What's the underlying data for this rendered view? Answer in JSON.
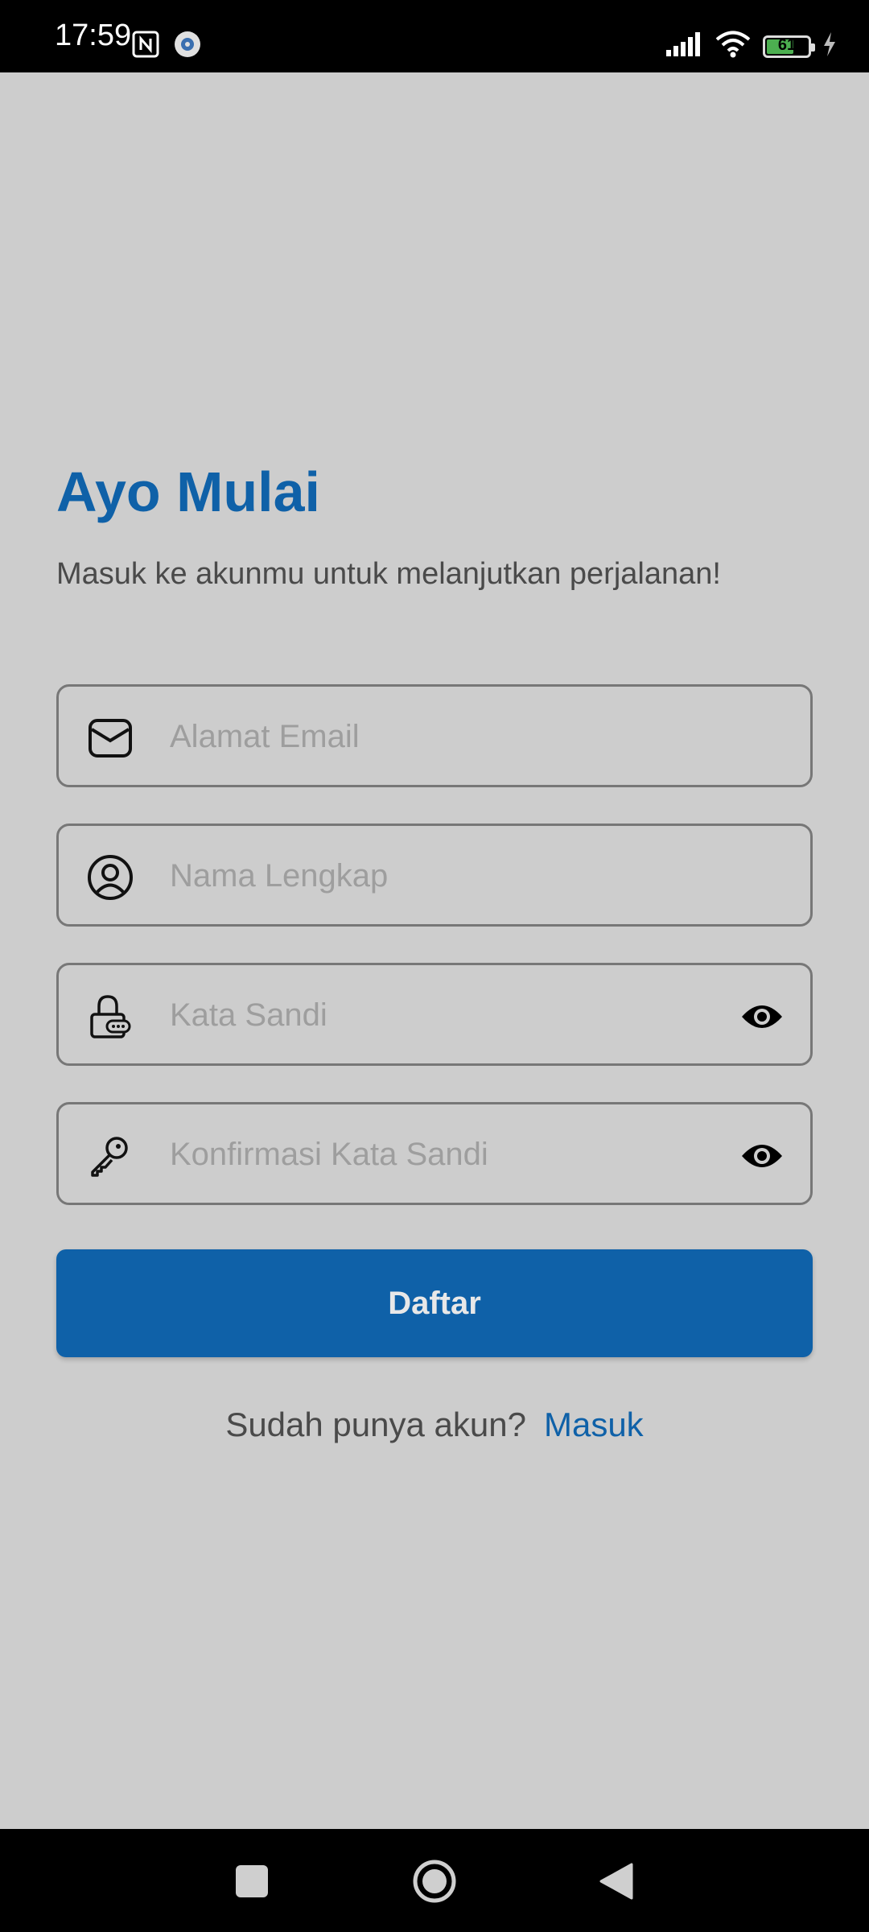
{
  "status_bar": {
    "time": "17:59",
    "battery_level": "61",
    "battery_color": "#4caf50"
  },
  "header": {
    "title": "Ayo Mulai",
    "subtitle": "Masuk ke akunmu untuk melanjutkan perjalanan!"
  },
  "form": {
    "email": {
      "placeholder": "Alamat Email",
      "value": "",
      "icon": "mail-icon"
    },
    "name": {
      "placeholder": "Nama Lengkap",
      "value": "",
      "icon": "user-circle-icon"
    },
    "password": {
      "placeholder": "Kata Sandi",
      "value": "",
      "icon": "lock-icon",
      "toggle_icon": "eye-icon"
    },
    "confirm_password": {
      "placeholder": "Konfirmasi Kata Sandi",
      "value": "",
      "icon": "key-icon",
      "toggle_icon": "eye-icon"
    },
    "submit_label": "Daftar"
  },
  "footer": {
    "login_prompt": "Sudah punya akun?",
    "login_link": "Masuk"
  },
  "colors": {
    "primary": "#0f61a8",
    "background": "#cdcdcd",
    "placeholder": "#9e9e9e"
  }
}
